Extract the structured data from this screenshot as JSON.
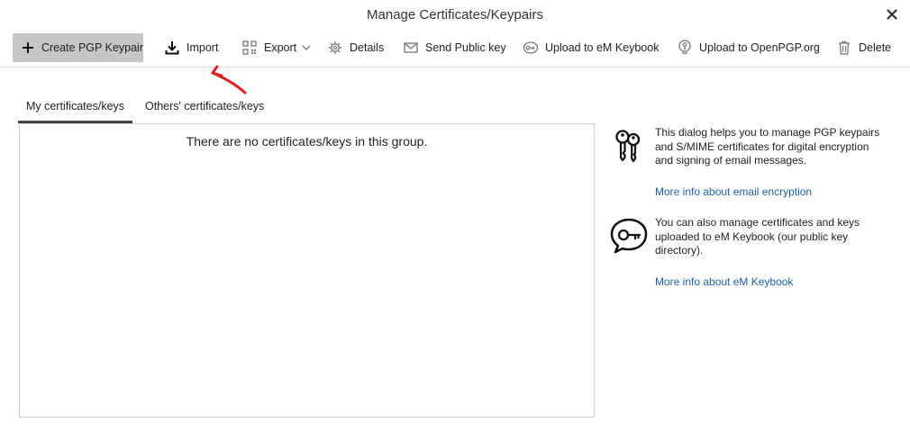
{
  "window": {
    "title": "Manage Certificates/Keypairs",
    "close_icon": "close-icon"
  },
  "toolbar": {
    "create_label": "Create PGP Keypair",
    "import_label": "Import",
    "export_label": "Export",
    "details_label": "Details",
    "send_label": "Send Public key",
    "upload_keybook_label": "Upload to eM Keybook",
    "upload_openpgp_label": "Upload to OpenPGP.org",
    "delete_label": "Delete"
  },
  "tabs": {
    "mine": "My certificates/keys",
    "others": "Others' certificates/keys"
  },
  "list": {
    "empty_message": "There are no certificates/keys in this group."
  },
  "info": {
    "encryption_text": "This dialog helps you to manage PGP keypairs and S/MIME certificates for digital encryption and signing of email messages.",
    "encryption_link": "More info about email encryption",
    "keybook_text": "You can also manage certificates and keys uploaded to eM Keybook (our public key directory).",
    "keybook_link": "More info about eM Keybook"
  },
  "colors": {
    "primary_button_bg": "#c6c6c6",
    "link": "#1f5fa6",
    "annotation_arrow": "#e02020"
  }
}
